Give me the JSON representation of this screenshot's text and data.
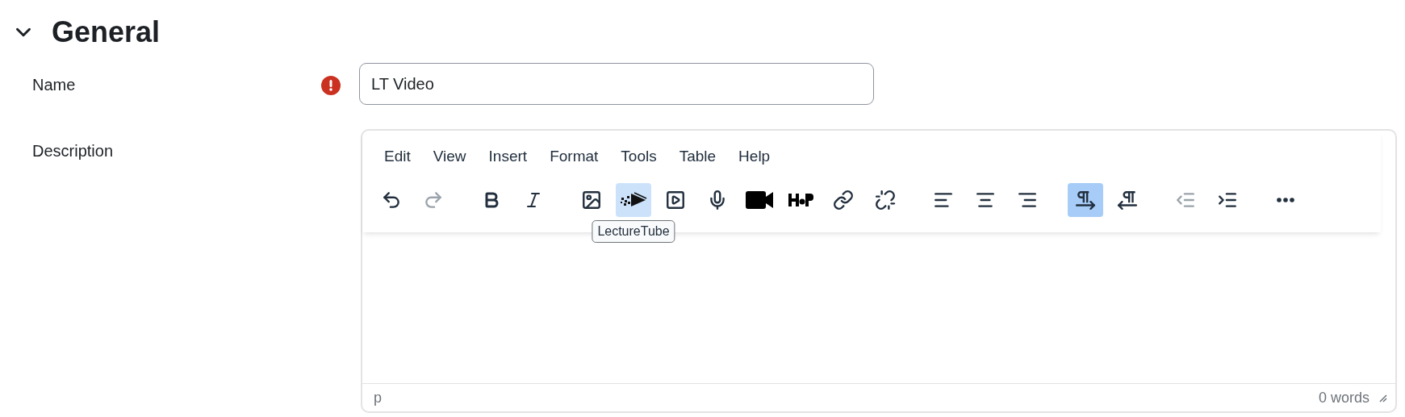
{
  "section": {
    "title": "General",
    "expanded": true
  },
  "fields": [
    {
      "label": "Name",
      "required_error": true,
      "kind": "text",
      "value": "LT Video"
    },
    {
      "label": "Description",
      "required_error": false,
      "kind": "editor"
    }
  ],
  "editor": {
    "menu": [
      "Edit",
      "View",
      "Insert",
      "Format",
      "Tools",
      "Table",
      "Help"
    ],
    "toolbar_groups": [
      [
        {
          "kind": "undo",
          "selected": false,
          "disabled": false
        },
        {
          "kind": "redo",
          "selected": false,
          "disabled": true
        }
      ],
      [
        {
          "kind": "bold",
          "selected": false,
          "disabled": false
        },
        {
          "kind": "italic",
          "selected": false,
          "disabled": false
        }
      ],
      [
        {
          "kind": "image",
          "selected": false,
          "disabled": false
        },
        {
          "kind": "lecturetube",
          "selected": true,
          "disabled": false,
          "tooltip": "LectureTube"
        },
        {
          "kind": "media",
          "selected": false,
          "disabled": false
        },
        {
          "kind": "microphone",
          "selected": false,
          "disabled": false
        },
        {
          "kind": "camera",
          "selected": false,
          "disabled": false
        },
        {
          "kind": "h5p",
          "selected": false,
          "disabled": false
        },
        {
          "kind": "link",
          "selected": false,
          "disabled": false
        },
        {
          "kind": "unlink",
          "selected": false,
          "disabled": false
        }
      ],
      [
        {
          "kind": "align-left",
          "selected": false,
          "disabled": false
        },
        {
          "kind": "align-center",
          "selected": false,
          "disabled": false
        },
        {
          "kind": "align-right",
          "selected": false,
          "disabled": false
        }
      ],
      [
        {
          "kind": "ltr",
          "selected": true,
          "disabled": false
        },
        {
          "kind": "rtl",
          "selected": false,
          "disabled": false
        }
      ],
      [
        {
          "kind": "outdent",
          "selected": false,
          "disabled": true
        },
        {
          "kind": "indent",
          "selected": false,
          "disabled": false
        }
      ],
      [
        {
          "kind": "more",
          "selected": false,
          "disabled": false
        }
      ]
    ],
    "status_path": "p",
    "word_count": "0 words"
  }
}
